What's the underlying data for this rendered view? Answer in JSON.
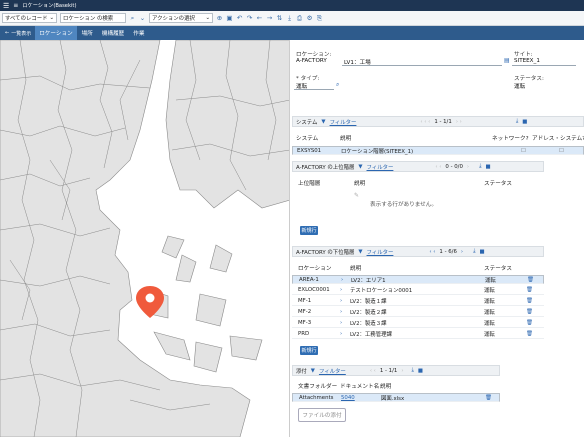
{
  "titlebar": {
    "title": "ロケーション(Basekit)"
  },
  "toolbar": {
    "record_filter": "すべてのレコード",
    "search_select": "ロケーション の検索",
    "action_select": "アクションの選択"
  },
  "nav": {
    "back": "一覧表示",
    "tabs": [
      "ロケーション",
      "場所",
      "機構履歴",
      "作業"
    ]
  },
  "form": {
    "location_label": "ロケーション:",
    "location_value": "A-FACTORY",
    "location_desc": "LV1：工場",
    "type_label": "* タイプ:",
    "type_value": "運転",
    "site_label": "サイト:",
    "site_value": "SITEEX_1",
    "status_label": "ステータス:",
    "status_value": "運転"
  },
  "system_panel": {
    "title": "システム",
    "filter": "フィルター",
    "pager": "1 - 1/1",
    "columns": [
      "システム",
      "説明",
      "ネットワーク?",
      "アドレス・システム?"
    ],
    "rows": [
      {
        "system": "EXSYS01",
        "desc": "ロケーション階層(SITEEX_1)"
      }
    ]
  },
  "parent_panel": {
    "title": "A-FACTORY の上位階層",
    "filter": "フィルター",
    "pager": "0 - 0/0",
    "columns": [
      "上位階層",
      "説明",
      "ステータス"
    ],
    "empty_text": "表示する行がありません。",
    "new_row": "新規行"
  },
  "child_panel": {
    "title": "A-FACTORY の下位階層",
    "filter": "フィルター",
    "pager": "1 - 6/6",
    "columns": [
      "ロケーション",
      "説明",
      "ステータス"
    ],
    "rows": [
      {
        "loc": "AREA-1",
        "desc": "LV2：エリア1",
        "status": "運転"
      },
      {
        "loc": "EXLOC0001",
        "desc": "テストロケーション0001",
        "status": "運転"
      },
      {
        "loc": "MF-1",
        "desc": "LV2：製造１課",
        "status": "運転"
      },
      {
        "loc": "MF-2",
        "desc": "LV2：製造２課",
        "status": "運転"
      },
      {
        "loc": "MF-3",
        "desc": "LV2：製造３課",
        "status": "運転"
      },
      {
        "loc": "PRD",
        "desc": "LV2：工務管理課",
        "status": "運転"
      }
    ],
    "new_row": "新規行"
  },
  "attach_panel": {
    "title": "添付",
    "filter": "フィルター",
    "pager": "1 - 1/1",
    "columns": [
      "文書フォルダー",
      "ドキュメント名",
      "説明"
    ],
    "rows": [
      {
        "folder": "Attachments",
        "doc": "5040",
        "desc": "図面.xlsx"
      }
    ],
    "add_file": "ファイルの添付"
  },
  "colors": {
    "nav": "#2e5b8c",
    "title": "#1e3553",
    "pin": "#f05a3c",
    "land": "#e3e3e3",
    "link": "#2b66b0"
  }
}
